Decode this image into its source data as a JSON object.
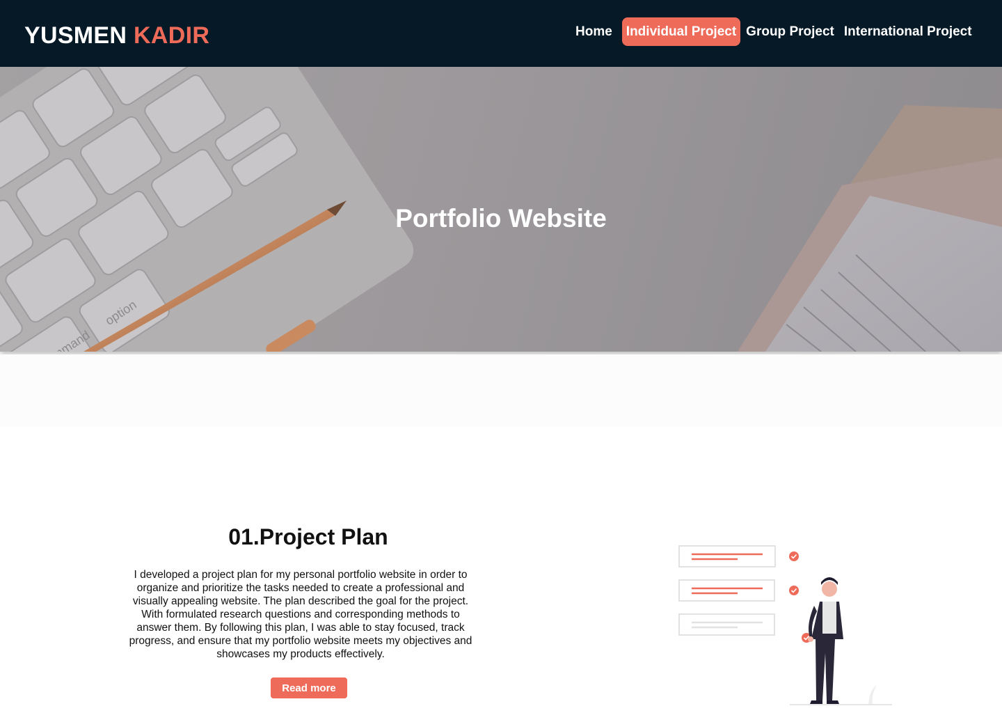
{
  "header": {
    "brand_first": "YUSMEN",
    "brand_second": "KADIR",
    "nav": [
      {
        "label": "Home",
        "active": false
      },
      {
        "label": "Individual Project",
        "active": true
      },
      {
        "label": "Group Project",
        "active": false
      },
      {
        "label": "International Project",
        "active": false
      }
    ]
  },
  "hero": {
    "title": "Portfolio Website",
    "image_description": "Keyboard, rose-gold pen and notebook on desk",
    "keyboard_keys": [
      "command",
      "option"
    ]
  },
  "project": {
    "title": "01.Project Plan",
    "description": "I developed a project plan for my personal portfolio website in order to organize and prioritize the tasks needed to create a professional and visually appealing website. The plan described the goal for the project. With formulated research questions and corresponding methods to answer them. By following this plan, I was able to stay focused, track progress, and ensure that my portfolio website meets my objectives and showcases my products effectively.",
    "button_label": "Read more"
  },
  "colors": {
    "navbar": "#051a26",
    "accent": "#ee6b5a",
    "text": "#111111"
  }
}
